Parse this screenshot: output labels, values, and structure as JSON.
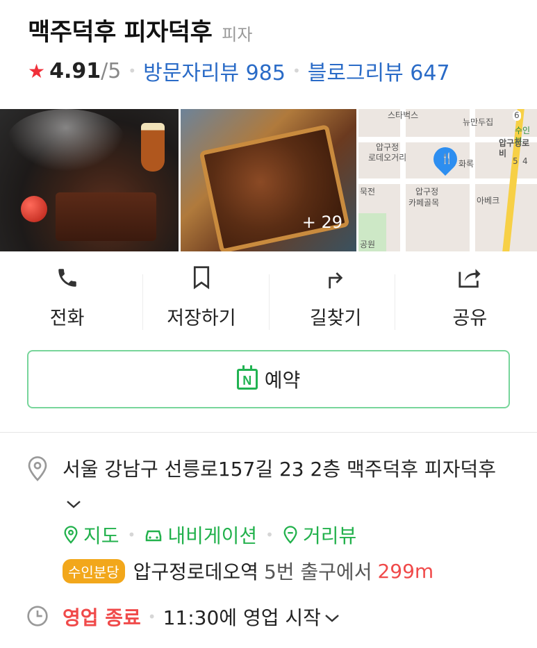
{
  "place": {
    "name": "맥주덕후 피자덕후",
    "category": "피자",
    "rating": "4.91",
    "rating_max": "/5",
    "visitor_reviews_label": "방문자리뷰 985",
    "blog_reviews_label": "블로그리뷰 647"
  },
  "photos": {
    "more_count": "+ 29",
    "map_labels": {
      "starbucks": "스타벅스",
      "newman": "뉴만두집",
      "station_badge": "수인분",
      "apgujeongro": "압구정로비",
      "rodeo_line1": "압구정",
      "rodeo_line2": "로데오거리",
      "cafe_line1": "압구정",
      "cafe_line2": "카페골목",
      "hwarok": "화록",
      "abekke": "아베크",
      "mukjeon": "묵전",
      "park": "공원",
      "num6": "6",
      "num5": "5",
      "num4": "4"
    }
  },
  "actions": [
    {
      "label": "전화",
      "icon": "phone-icon"
    },
    {
      "label": "저장하기",
      "icon": "bookmark-icon"
    },
    {
      "label": "길찾기",
      "icon": "directions-icon"
    },
    {
      "label": "공유",
      "icon": "share-icon"
    }
  ],
  "reserve": {
    "label": "예약",
    "icon_letter": "N"
  },
  "address": {
    "text": "서울 강남구 선릉로157길 23 2층 맥주덕후 피자덕후"
  },
  "links": [
    {
      "label": "지도",
      "icon": "map-pin-icon"
    },
    {
      "label": "내비게이션",
      "icon": "car-icon"
    },
    {
      "label": "거리뷰",
      "icon": "streetview-icon"
    }
  ],
  "station": {
    "line": "수인분당",
    "name": "압구정로데오역",
    "exit": "5번 출구에서",
    "distance": "299m"
  },
  "hours": {
    "status": "영업 종료",
    "text": "11:30에 영업 시작"
  },
  "colors": {
    "accent_blue": "#2a6bc7",
    "naver_green": "#21b352",
    "status_red": "#f04a4a",
    "star_red": "#f0303a",
    "line_badge": "#f2a71b"
  }
}
